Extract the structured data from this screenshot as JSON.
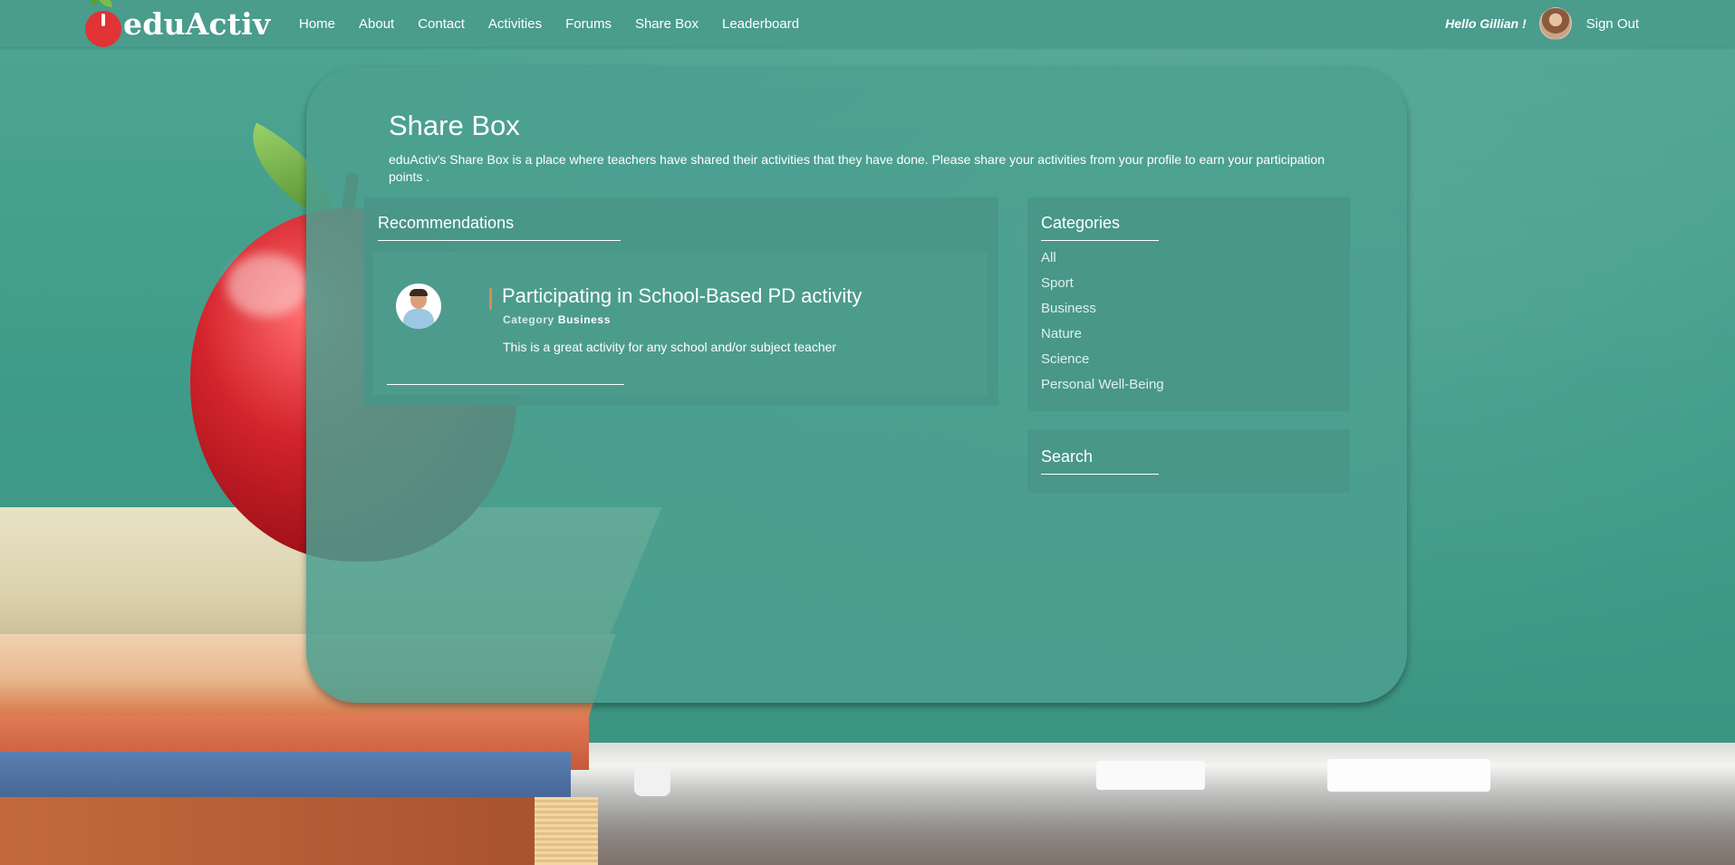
{
  "brand": {
    "name": "eduActiv"
  },
  "nav": {
    "links": [
      "Home",
      "About",
      "Contact",
      "Activities",
      "Forums",
      "Share Box",
      "Leaderboard"
    ],
    "greeting": "Hello Gillian !",
    "sign_out": "Sign Out"
  },
  "page": {
    "title": "Share Box",
    "description": "eduActiv's Share Box is a place where teachers have shared their activities that they have done. Please share your activities from your profile to earn your participation points ."
  },
  "recommendations": {
    "title": "Recommendations",
    "items": [
      {
        "title": "Participating in School-Based PD activity",
        "category_label": "Category",
        "category": "Business",
        "description": "This is a great activity for any school and/or subject teacher"
      }
    ]
  },
  "categories": {
    "title": "Categories",
    "items": [
      "All",
      "Sport",
      "Business",
      "Nature",
      "Science",
      "Personal Well-Being"
    ]
  },
  "search": {
    "title": "Search"
  },
  "colors": {
    "navbar": "#4a9c8c",
    "panel": "#4ca090",
    "accent": "#d98a55",
    "logo_red": "#e23337",
    "logo_leaf": "#7bc043"
  }
}
